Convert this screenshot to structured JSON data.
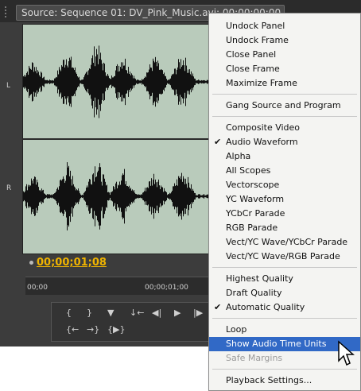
{
  "source_tab": {
    "title": "Source: Sequence 01: DV_Pink_Music.avi: 00;00;00;00"
  },
  "channels": {
    "left": "L",
    "right": "R"
  },
  "timecode": "00;00;01;08",
  "ruler": {
    "start": "00;00",
    "end": "00;00;01;00"
  },
  "transport": {
    "b1": "{",
    "b2": "}",
    "b3": "▼",
    "b4": "↓←",
    "b5": "◀|",
    "b6": "▶",
    "b7": "|▶",
    "b8": "{←",
    "b9": "→}",
    "b10": "{▶}"
  },
  "menu": [
    {
      "label": "Undock Panel"
    },
    {
      "label": "Undock Frame"
    },
    {
      "label": "Close Panel"
    },
    {
      "label": "Close Frame"
    },
    {
      "label": "Maximize Frame"
    },
    {
      "label": "Gang Source and Program"
    },
    {
      "label": "Composite Video"
    },
    {
      "label": "Audio Waveform",
      "check": "✔"
    },
    {
      "label": "Alpha"
    },
    {
      "label": "All Scopes"
    },
    {
      "label": "Vectorscope"
    },
    {
      "label": "YC Waveform"
    },
    {
      "label": "YCbCr Parade"
    },
    {
      "label": "RGB Parade"
    },
    {
      "label": "Vect/YC Wave/YCbCr Parade"
    },
    {
      "label": "Vect/YC Wave/RGB Parade"
    },
    {
      "label": "Highest Quality"
    },
    {
      "label": "Draft Quality"
    },
    {
      "label": "Automatic Quality",
      "check": "✔"
    },
    {
      "label": "Loop"
    },
    {
      "label": "Show Audio Time Units"
    },
    {
      "label": "Safe Margins"
    },
    {
      "label": "Playback Settings..."
    }
  ],
  "colors": {
    "highlight": "#3169c6",
    "timecode": "#f0b400",
    "waveform_bg": "#b9cbbb"
  }
}
